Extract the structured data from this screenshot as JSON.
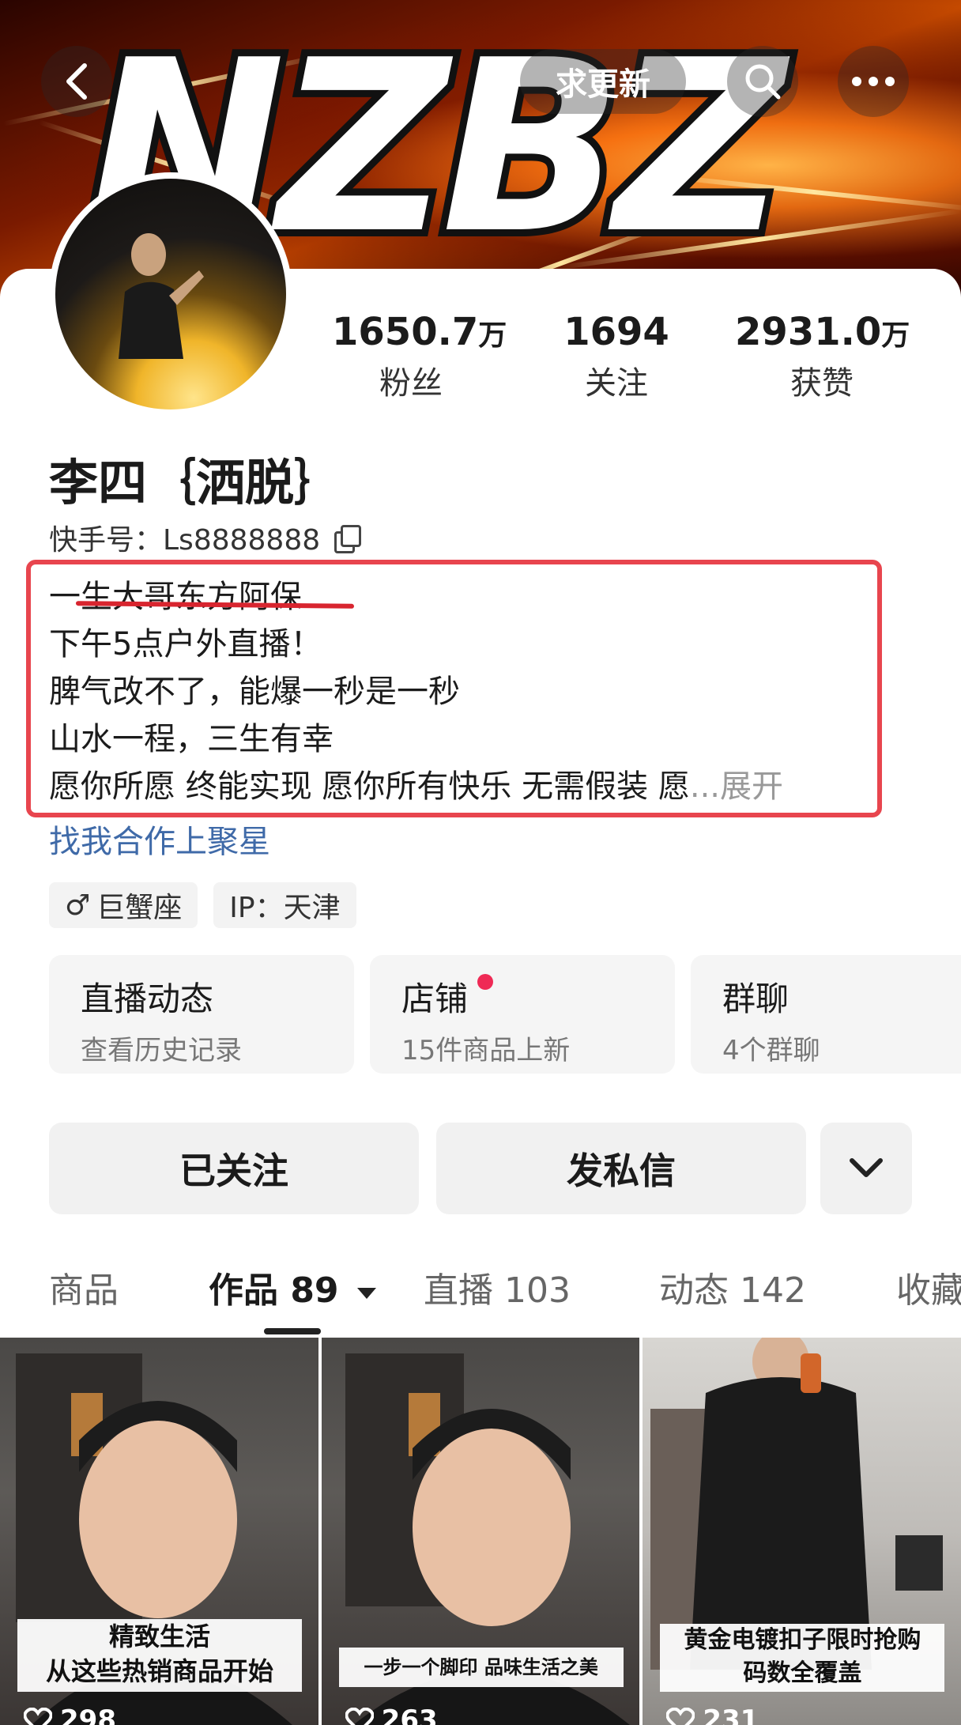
{
  "header": {
    "logo_text": "NZBZ",
    "update_label": "求更新",
    "back_icon": "back-arrow-icon",
    "search_icon": "search-icon",
    "more_icon": "more-dots-icon"
  },
  "stats": [
    {
      "number": "1650.7",
      "unit": "万",
      "label": "粉丝"
    },
    {
      "number": "1694",
      "unit": "",
      "label": "关注"
    },
    {
      "number": "2931.0",
      "unit": "万",
      "label": "获赞"
    }
  ],
  "profile": {
    "name": "李四｛洒脱｝",
    "kuaishou_id": "快手号：Ls8888888",
    "bio": [
      "一生大哥东方阿保",
      "下午5点户外直播！",
      "脾气改不了，能爆一秒是一秒",
      "山水一程，三生有幸",
      "愿你所愿 终能实现 愿你所有快乐 无需假装 愿"
    ],
    "bio_ellipsis": "...",
    "expand_label": "展开",
    "collab_link": "找我合作上聚星",
    "tags": [
      {
        "icon": "male-icon",
        "symbol": "♂",
        "text": "巨蟹座"
      },
      {
        "text": "IP：天津"
      }
    ]
  },
  "tiles": [
    {
      "title": "直播动态",
      "subtitle": "查看历史记录"
    },
    {
      "title": "店铺",
      "subtitle": "15件商品上新"
    },
    {
      "title": "群聊",
      "subtitle": "4个群聊"
    }
  ],
  "buttons": {
    "follow": "已关注",
    "message": "发私信",
    "dropdown_icon": "chevron-down-icon"
  },
  "tabs": [
    {
      "label": "商品"
    },
    {
      "label": "作品 89",
      "active": true
    },
    {
      "label": "直播 103"
    },
    {
      "label": "动态 142"
    },
    {
      "label": "收藏"
    }
  ],
  "videos": [
    {
      "caption": [
        "精致生活",
        "从这些热销商品开始"
      ],
      "likes": "298"
    },
    {
      "caption": [
        "一步一个脚印 品味生活之美"
      ],
      "likes": "263"
    },
    {
      "caption": [
        "黄金电镀扣子限时抢购",
        "码数全覆盖"
      ],
      "likes": "231"
    }
  ],
  "colors": {
    "highlight_box": "#e8454e",
    "link": "#3f6aa8",
    "notify_dot": "#ef2a55"
  }
}
